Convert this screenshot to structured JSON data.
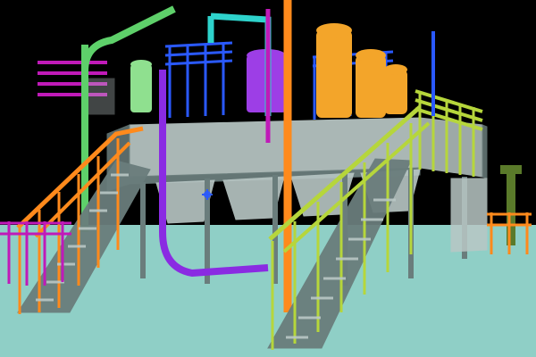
{
  "scene": {
    "background_color": "#000000",
    "floor_color": "#8fcfc6",
    "palette": {
      "green_pipe": "#5ed06a",
      "purple_pipe": "#8a2be2",
      "magenta_pipe": "#c01ab8",
      "orange_pipe": "#ff8a1c",
      "yellow_green_pipe": "#b6d63b",
      "cyan_pipe": "#2ed3cc",
      "blue_pipe": "#2a59ff",
      "steel": "#6a7d7c",
      "steel_light": "#b9c7c5",
      "tank_orange": "#f3a52a",
      "tank_purple": "#9d3ee6",
      "tank_green": "#8fe08f",
      "dark_olive": "#5a7a2a"
    },
    "components": [
      "elevated-platform",
      "storage-tank",
      "hopper",
      "staircase",
      "handrail",
      "pipe-run",
      "support-column",
      "selection-marker"
    ]
  }
}
